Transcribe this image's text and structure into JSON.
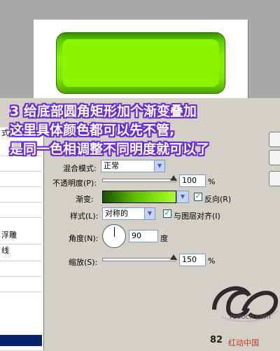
{
  "tutorial": {
    "line1": "3 给底部圆角矩形加个渐变叠加",
    "line2": "这里具体颜色都可以先不管,",
    "line3": "是同一色相调整不同明度就可以了"
  },
  "left_panel": {
    "partial_items": [
      "式)",
      "",
      "",
      "",
      "",
      "浮雕",
      "线",
      "",
      "",
      "",
      "",
      "",
      "",
      ""
    ]
  },
  "form": {
    "blend_mode_label": "混合模式:",
    "blend_mode_value": "正常",
    "opacity_label": "不透明度(P):",
    "opacity_value": "100",
    "opacity_unit": "%",
    "gradient_label": "渐变:",
    "reverse_label": "反向(R)",
    "reverse_checked": true,
    "style_label": "样式(L):",
    "style_value": "对称的",
    "align_label": "与图层对齐(I)",
    "align_checked": true,
    "angle_label": "角度(N):",
    "angle_value": "90",
    "angle_unit": "度",
    "scale_label": "缩放(S):",
    "scale_value": "150",
    "scale_unit": "%"
  },
  "watermark": {
    "url": "redocn.com",
    "brand": "红动中国",
    "number": "82"
  },
  "colors": {
    "tutorial_text": "#ffffff",
    "tutorial_outline": "#6a2bd6",
    "rect_green": "#86f000",
    "selection": "#0a246a"
  }
}
